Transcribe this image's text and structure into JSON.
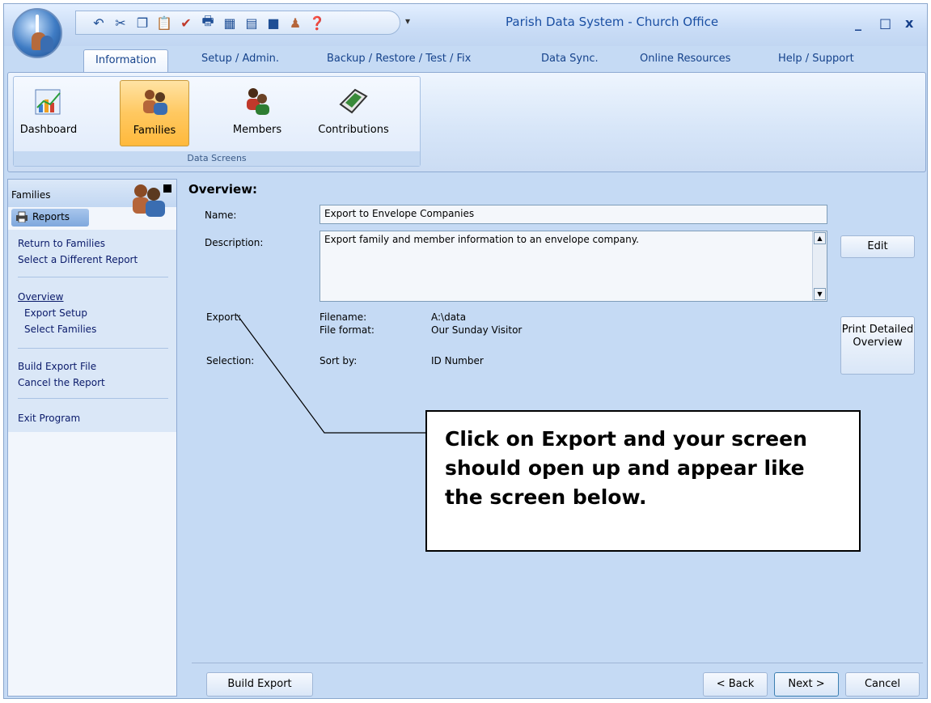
{
  "window": {
    "title": "Parish Data System - Church Office",
    "minimize": "_",
    "maximize": "□",
    "close": "x"
  },
  "tabs": [
    {
      "label": "Information",
      "active": true
    },
    {
      "label": "Setup / Admin."
    },
    {
      "label": "Backup / Restore / Test / Fix"
    },
    {
      "label": "Data Sync."
    },
    {
      "label": "Online Resources"
    },
    {
      "label": "Help / Support"
    }
  ],
  "ribbon": {
    "group_label": "Data Screens",
    "buttons": [
      {
        "label": "Dashboard"
      },
      {
        "label": "Families",
        "active": true
      },
      {
        "label": "Members"
      },
      {
        "label": "Contributions"
      }
    ]
  },
  "left_panel": {
    "title": "Families",
    "section": "Reports",
    "items": [
      "Return to Families",
      "Select a Different Report",
      "Overview",
      "Export Setup",
      "Select Families",
      "Build Export File",
      "Cancel the Report",
      "Exit Program"
    ]
  },
  "overview": {
    "heading": "Overview:",
    "name_label": "Name:",
    "name_value": "Export to Envelope Companies",
    "description_label": "Description:",
    "description_value": "Export family and member information to an envelope company.",
    "edit_button": "Edit",
    "export_label": "Export:",
    "filename_label": "Filename:",
    "filename_value": "A:\\data",
    "file_format_label": "File format:",
    "file_format_value": "Our Sunday Visitor",
    "selection_label": "Selection:",
    "sort_by_label": "Sort by:",
    "sort_by_value": "ID Number",
    "print_button": "Print Detailed Overview"
  },
  "callout": {
    "text": "Click on Export and your screen should open up and appear like the screen below."
  },
  "footer": {
    "build_export": "Build Export",
    "back": "< Back",
    "next": "Next >",
    "cancel": "Cancel"
  }
}
